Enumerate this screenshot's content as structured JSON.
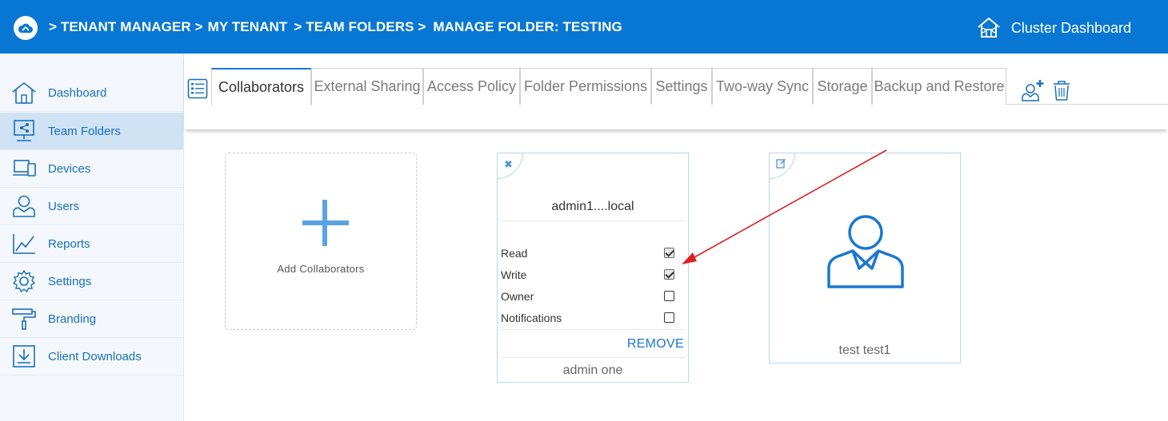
{
  "header": {
    "breadcrumb": [
      "> TENANT MANAGER >",
      "MY TENANT",
      "> TEAM FOLDERS >",
      "MANAGE FOLDER: TESTING"
    ],
    "cluster_label": "Cluster Dashboard",
    "color": "#0877d4"
  },
  "sidebar": {
    "items": [
      {
        "label": "Dashboard",
        "icon": "house-icon"
      },
      {
        "label": "Team Folders",
        "icon": "folder-share-icon",
        "active": true
      },
      {
        "label": "Devices",
        "icon": "devices-icon"
      },
      {
        "label": "Users",
        "icon": "user-icon"
      },
      {
        "label": "Reports",
        "icon": "chart-icon"
      },
      {
        "label": "Settings",
        "icon": "gear-icon"
      },
      {
        "label": "Branding",
        "icon": "paint-roller-icon"
      },
      {
        "label": "Client Downloads",
        "icon": "download-icon"
      }
    ]
  },
  "tabs": [
    {
      "label": "Collaborators",
      "active": true
    },
    {
      "label": "External Sharing"
    },
    {
      "label": "Access Policy"
    },
    {
      "label": "Folder Permissions"
    },
    {
      "label": "Settings"
    },
    {
      "label": "Two-way Sync"
    },
    {
      "label": "Storage"
    },
    {
      "label": "Backup and Restore"
    }
  ],
  "add_card": {
    "label": "Add Collaborators"
  },
  "collaborator_card": {
    "email": "admin1....local",
    "permissions": [
      {
        "label": "Read",
        "checked": true
      },
      {
        "label": "Write",
        "checked": true
      },
      {
        "label": "Owner",
        "checked": false
      },
      {
        "label": "Notifications",
        "checked": false
      }
    ],
    "remove_label": "REMOVE",
    "name": "admin one"
  },
  "user_card": {
    "name": "test test1"
  },
  "colors": {
    "accent": "#1a77d2",
    "annotation_arrow": "#e02020"
  }
}
